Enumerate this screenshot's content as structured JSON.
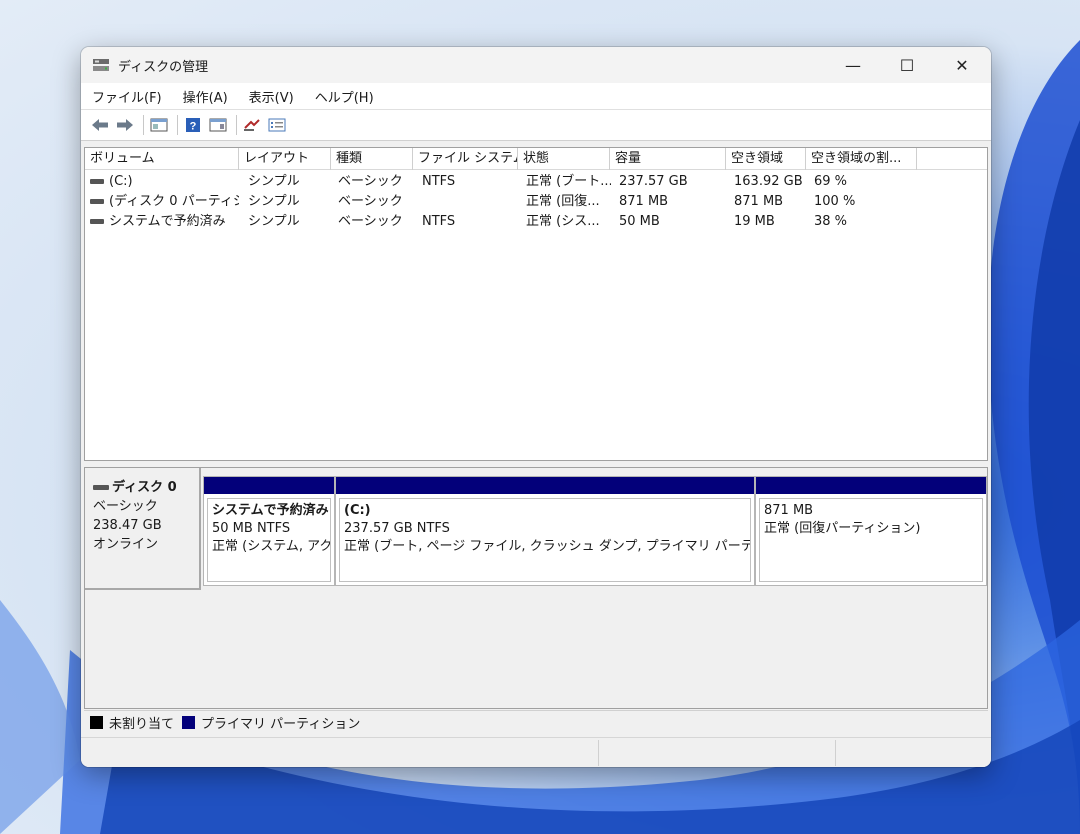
{
  "window": {
    "title": "ディスクの管理",
    "controls": {
      "minimize": "—",
      "maximize": "☐",
      "close": "✕"
    }
  },
  "menu": {
    "file": "ファイル(F)",
    "action": "操作(A)",
    "view": "表示(V)",
    "help": "ヘルプ(H)"
  },
  "toolbar": {
    "buttons": [
      "back-icon",
      "forward-icon",
      "show-hide-console-tree-icon",
      "help-icon",
      "show-hide-action-pane-icon",
      "connect-icon",
      "properties-icon"
    ]
  },
  "volume_list": {
    "columns": [
      "ボリューム",
      "レイアウト",
      "種類",
      "ファイル システム",
      "状態",
      "容量",
      "空き領域",
      "空き領域の割..."
    ],
    "rows": [
      {
        "volume": "(C:)",
        "layout": "シンプル",
        "type": "ベーシック",
        "fs": "NTFS",
        "status": "正常 (ブート...",
        "capacity": "237.57 GB",
        "free": "163.92 GB",
        "pct": "69 %"
      },
      {
        "volume": "(ディスク 0 パーティシ...",
        "layout": "シンプル",
        "type": "ベーシック",
        "fs": "",
        "status": "正常 (回復...",
        "capacity": "871 MB",
        "free": "871 MB",
        "pct": "100 %"
      },
      {
        "volume": "システムで予約済み",
        "layout": "シンプル",
        "type": "ベーシック",
        "fs": "NTFS",
        "status": "正常 (シス...",
        "capacity": "50 MB",
        "free": "19 MB",
        "pct": "38 %"
      }
    ]
  },
  "disk": {
    "name": "ディスク 0",
    "type": "ベーシック",
    "size": "238.47 GB",
    "state": "オンライン",
    "partitions": [
      {
        "name": "システムで予約済み",
        "size_fs": "50 MB NTFS",
        "status": "正常 (システム, アク"
      },
      {
        "name": "(C:)",
        "size_fs": "237.57 GB NTFS",
        "status": "正常 (ブート, ページ ファイル, クラッシュ ダンプ, プライマリ パーティション)"
      },
      {
        "name": "",
        "size_fs": "871 MB",
        "status": "正常 (回復パーティション)"
      }
    ]
  },
  "legend": {
    "unallocated": "未割り当て",
    "primary": "プライマリ パーティション",
    "colors": {
      "unallocated": "#000000",
      "primary": "#03007a"
    }
  }
}
